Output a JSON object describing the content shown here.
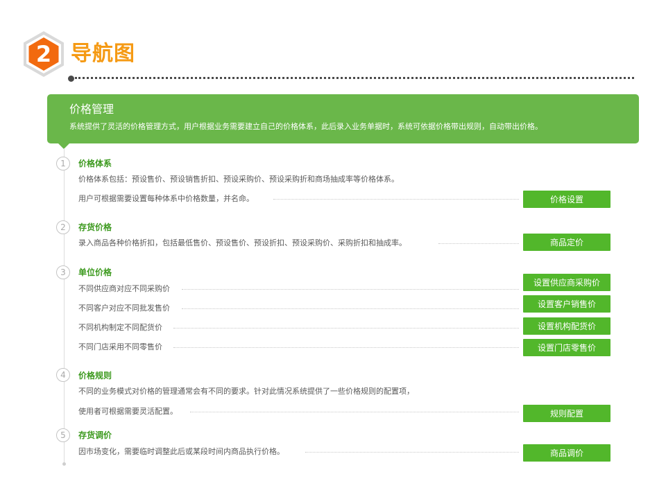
{
  "header": {
    "badge_number": "2",
    "title": "导航图"
  },
  "banner": {
    "title": "价格管理",
    "description": "系统提供了灵活的价格管理方式，用户根据业务需要建立自己的价格体系，此后录入业务单据时，系统可依据价格带出规则，自动带出价格。"
  },
  "sections": [
    {
      "step": "1",
      "title": "价格体系",
      "lines": [
        "价格体系包括：预设售价、预设销售折扣、预设采购价、预设采购折和商场抽成率等价格体系。",
        "用户可根据需要设置每种体系中价格数量，并名命。"
      ],
      "buttons": [
        "价格设置"
      ]
    },
    {
      "step": "2",
      "title": "存货价格",
      "lines": [
        "录入商品各种价格折扣，包括最低售价、预设售价、预设折扣、预设采购价、采购折扣和抽成率。"
      ],
      "buttons": [
        "商品定价"
      ]
    },
    {
      "step": "3",
      "title": "单位价格",
      "lines": [
        "不同供应商对应不同采购价",
        "不同客户对应不同批发售价",
        "不同机构制定不同配货价",
        "不同门店采用不同零售价"
      ],
      "buttons": [
        "设置供应商采购价",
        "设置客户销售价",
        "设置机构配货价",
        "设置门店零售价"
      ]
    },
    {
      "step": "4",
      "title": "价格规则",
      "lines": [
        "不同的业务模式对价格的管理通常会有不同的要求。针对此情况系统提供了一些价格规则的配置项，",
        "使用者可根据需要灵活配置。"
      ],
      "buttons": [
        "规则配置"
      ]
    },
    {
      "step": "5",
      "title": "存货调价",
      "lines": [
        "因市场变化，需要临时调整此后或某段时间内商品执行价格。"
      ],
      "buttons": [
        "商品调价"
      ]
    }
  ],
  "colors": {
    "accent_orange": "#f59a14",
    "banner_green": "#6ab74a",
    "button_green": "#52b72b",
    "title_green": "#3d9a1f"
  }
}
